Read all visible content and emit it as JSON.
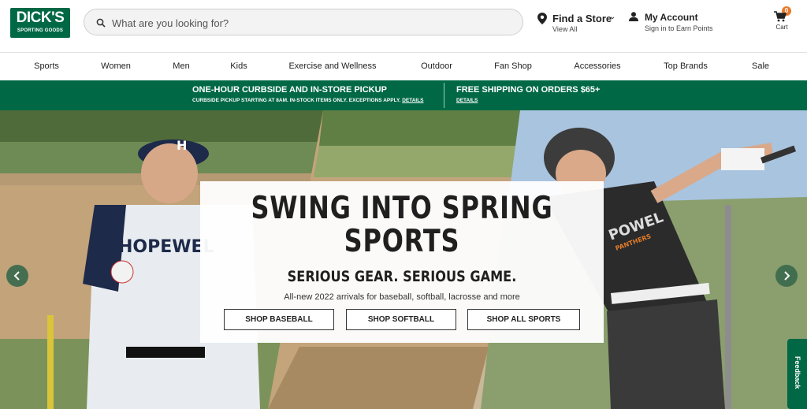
{
  "header": {
    "logo_main": "DICK'S",
    "logo_sub": "SPORTING GOODS",
    "search_placeholder": "What are you looking for?",
    "store_title": "Find a Store",
    "store_sub": "View All",
    "account_title": "My Account",
    "account_sub": "Sign in to Earn Points",
    "cart_label": "Cart",
    "cart_count": "0"
  },
  "nav": {
    "items": [
      {
        "label": "Sports"
      },
      {
        "label": "Women"
      },
      {
        "label": "Men"
      },
      {
        "label": "Kids"
      },
      {
        "label": "Exercise and Wellness"
      },
      {
        "label": "Outdoor"
      },
      {
        "label": "Fan Shop"
      },
      {
        "label": "Accessories"
      },
      {
        "label": "Top Brands"
      },
      {
        "label": "Sale"
      }
    ]
  },
  "promo": {
    "left_title": "ONE-HOUR CURBSIDE AND IN-STORE PICKUP",
    "left_sub": "CURBSIDE PICKUP STARTING AT 8AM. IN-STOCK ITEMS ONLY. EXCEPTIONS APPLY.",
    "left_link": "DETAILS",
    "right_title": "FREE SHIPPING ON ORDERS $65+",
    "right_link": "DETAILS"
  },
  "hero": {
    "title_line1": "SWING INTO SPRING",
    "title_line2": "SPORTS",
    "subtitle": "SERIOUS GEAR. SERIOUS GAME.",
    "description": "All-new 2022 arrivals for baseball, softball, lacrosse and more",
    "buttons": [
      {
        "label": "SHOP BASEBALL"
      },
      {
        "label": "SHOP SOFTBALL"
      },
      {
        "label": "SHOP ALL SPORTS"
      }
    ],
    "left_jersey_text": "HOPEWEL",
    "left_cap_letter": "H",
    "right_jersey_text": "POWEL",
    "right_jersey_sub": "PANTHERS"
  },
  "feedback_label": "Feedback",
  "colors": {
    "brand_green": "#006845",
    "badge_orange": "#e8792b"
  }
}
